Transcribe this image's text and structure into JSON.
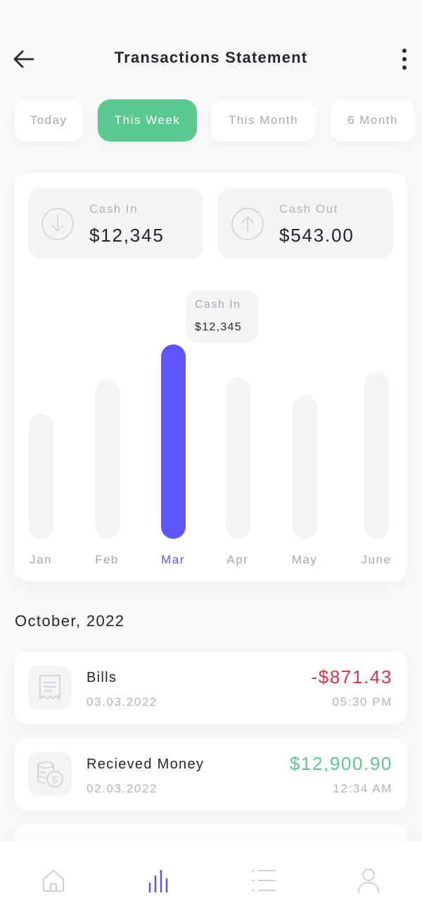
{
  "header": {
    "title": "Transactions Statement",
    "back_icon": "arrow-left-icon",
    "more_icon": "more-vertical-icon"
  },
  "periods": [
    {
      "label": "Today",
      "active": false
    },
    {
      "label": "This Week",
      "active": true
    },
    {
      "label": "This Month",
      "active": false
    },
    {
      "label": "6 Month",
      "active": false
    }
  ],
  "summary": {
    "cash_in": {
      "label": "Cash In",
      "value": "$12,345",
      "icon": "arrow-down-circle-icon"
    },
    "cash_out": {
      "label": "Cash Out",
      "value": "$543.00",
      "icon": "arrow-up-circle-icon"
    }
  },
  "tooltip": {
    "label": "Cash In",
    "value": "$12,345"
  },
  "chart_data": {
    "type": "bar",
    "categories": [
      "Jan",
      "Feb",
      "Mar",
      "Apr",
      "May",
      "June"
    ],
    "values": [
      0.64,
      0.82,
      1.0,
      0.83,
      0.74,
      0.86
    ],
    "highlighted": "Mar",
    "colors": {
      "highlight": "#5b55fb",
      "track": "#f4f4f6"
    }
  },
  "section": {
    "title": "October, 2022"
  },
  "transactions": [
    {
      "name": "Bills",
      "date": "03.03.2022",
      "amount": "-$871.43",
      "time": "05:30 PM",
      "type": "debit",
      "icon": "receipt-icon"
    },
    {
      "name": "Recieved Money",
      "date": "02.03.2022",
      "amount": "$12,900.90",
      "time": "12:34 AM",
      "type": "credit",
      "icon": "coins-icon"
    }
  ],
  "nav": [
    {
      "icon": "home-icon",
      "active": false
    },
    {
      "icon": "bar-chart-icon",
      "active": true
    },
    {
      "icon": "list-icon",
      "active": false
    },
    {
      "icon": "user-icon",
      "active": false
    }
  ],
  "colors": {
    "accent_green": "#5cc88d",
    "accent_purple": "#5b55fb",
    "negative_red": "#df3446"
  }
}
